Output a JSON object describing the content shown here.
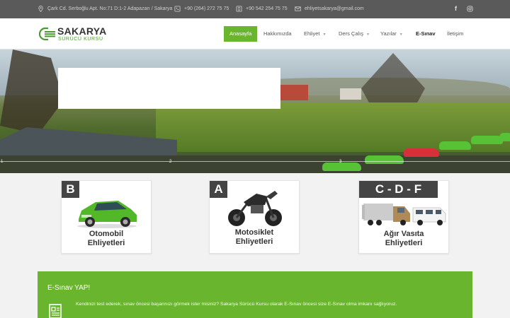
{
  "topbar": {
    "address": "Çark Cd. Serboğlu Apt. No:71 D:1-2 Adapazarı / Sakarya",
    "phone": "+90 (264) 272 75 75",
    "mobile": "+90 542 254 75 75",
    "email": "ehliyetsakarya@gmail.com",
    "social": [
      "f",
      "instagram"
    ]
  },
  "logo": {
    "title": "SAKARYA",
    "subtitle": "SÜRÜCÜ KURSU"
  },
  "nav": {
    "items": [
      {
        "label": "Anasayfa"
      },
      {
        "label": "Hakkımızda"
      },
      {
        "label": "Ehliyet"
      },
      {
        "label": "Ders Çalış"
      },
      {
        "label": "Yazılar"
      },
      {
        "label": "E-Sınav"
      },
      {
        "label": "İletişim"
      }
    ]
  },
  "hero": {
    "slides": [
      "1",
      "2",
      "3"
    ]
  },
  "cards": [
    {
      "badge": "B",
      "line1": "Otomobil",
      "line2": "Ehliyetleri"
    },
    {
      "badge": "A",
      "line1": "Motosiklet",
      "line2": "Ehliyetleri"
    },
    {
      "badge": "C - D - F",
      "line1": "Ağır Vasıta",
      "line2": "Ehliyetleri"
    }
  ],
  "esinav": {
    "title": "E-Sınav YAP!",
    "text": "Kendinizi test ederek, sınav öncesi başarınızı görmek ister misiniz? Sakarya Sürücü Kursu olarak E-Sınav öncesi size E-Sınav olma imkanı sağlıyoruz."
  },
  "colors": {
    "accent": "#6ab52e",
    "topbar": "#5a5a5a",
    "badge": "#444444"
  }
}
